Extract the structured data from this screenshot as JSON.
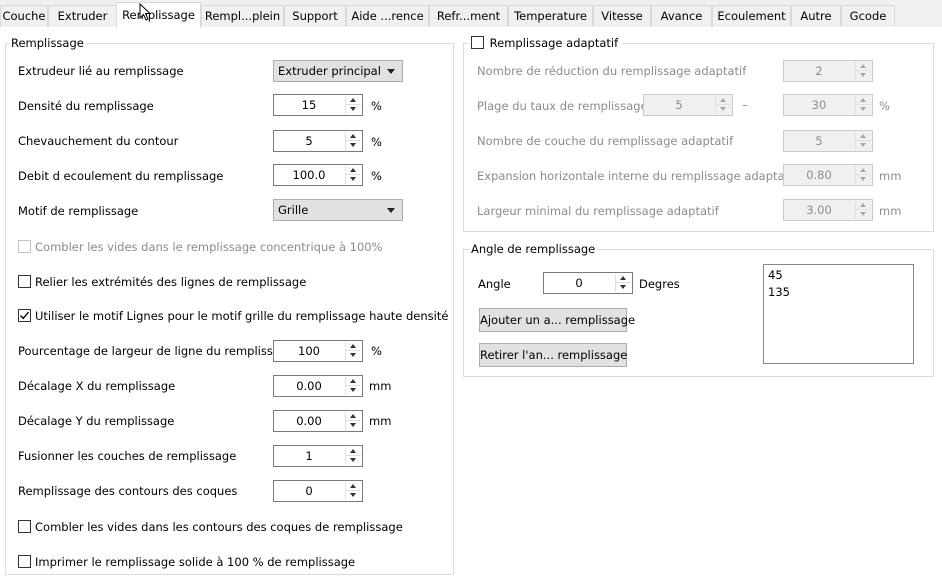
{
  "tabs": [
    "Couche",
    "Extruder",
    "Remplissage",
    "Rempl...plein",
    "Support",
    "Aide ...rence",
    "Refr...ment",
    "Temperature",
    "Vitesse",
    "Avance",
    "Ecoulement",
    "Autre",
    "Gcode"
  ],
  "infill": {
    "title": "Remplissage",
    "extruder_label": "Extrudeur lié au remplissage",
    "extruder_value": "Extruder principal",
    "density_label": "Densité du remplissage",
    "density_value": "15",
    "overlap_label": "Chevauchement du contour",
    "overlap_value": "5",
    "flow_label": "Debit d ecoulement du remplissage",
    "flow_value": "100.0",
    "pattern_label": "Motif de remplissage",
    "pattern_value": "Grille",
    "fill_gaps_concentric_label": "Combler les vides dans le remplissage concentrique à 100%",
    "connect_lines_label": "Relier les extrémités des lignes de remplissage",
    "use_lines_label": "Utiliser le motif Lignes pour le motif grille du remplissage haute densité",
    "width_pct_label": "Pourcentage de largeur de ligne du remplissage",
    "width_pct_value": "100",
    "offset_x_label": "Décalage X du remplissage",
    "offset_x_value": "0.00",
    "offset_y_label": "Décalage Y du remplissage",
    "offset_y_value": "0.00",
    "merge_layers_label": "Fusionner les couches de remplissage",
    "merge_layers_value": "1",
    "shell_fill_label": "Remplissage des contours des coques",
    "shell_fill_value": "0",
    "fill_shell_gaps_label": "Combler les vides dans les contours des coques de remplissage",
    "print_solid_label": "Imprimer le remplissage solide à 100 % de remplissage",
    "unit_pct": "%",
    "unit_mm": "mm"
  },
  "adaptive": {
    "title": "Remplissage adaptatif",
    "reductions_label": "Nombre de réduction du remplissage adaptatif",
    "reductions_value": "2",
    "range_label": "Plage du taux de remplissage",
    "range_min": "5",
    "range_sep": "–",
    "range_max": "30",
    "layers_label": "Nombre de couche du remplissage adaptatif",
    "layers_value": "5",
    "expansion_label": "Expansion horizontale interne du remplissage adaptatif",
    "expansion_value": "0.80",
    "min_width_label": "Largeur minimal du remplissage adaptatif",
    "min_width_value": "3.00"
  },
  "angle": {
    "title": "Angle de remplissage",
    "angle_label": "Angle",
    "angle_value": "0",
    "angle_unit": "Degres",
    "add_button": "Ajouter un a... remplissage",
    "remove_button": "Retirer l'an... remplissage",
    "list": [
      "45",
      "135"
    ]
  }
}
